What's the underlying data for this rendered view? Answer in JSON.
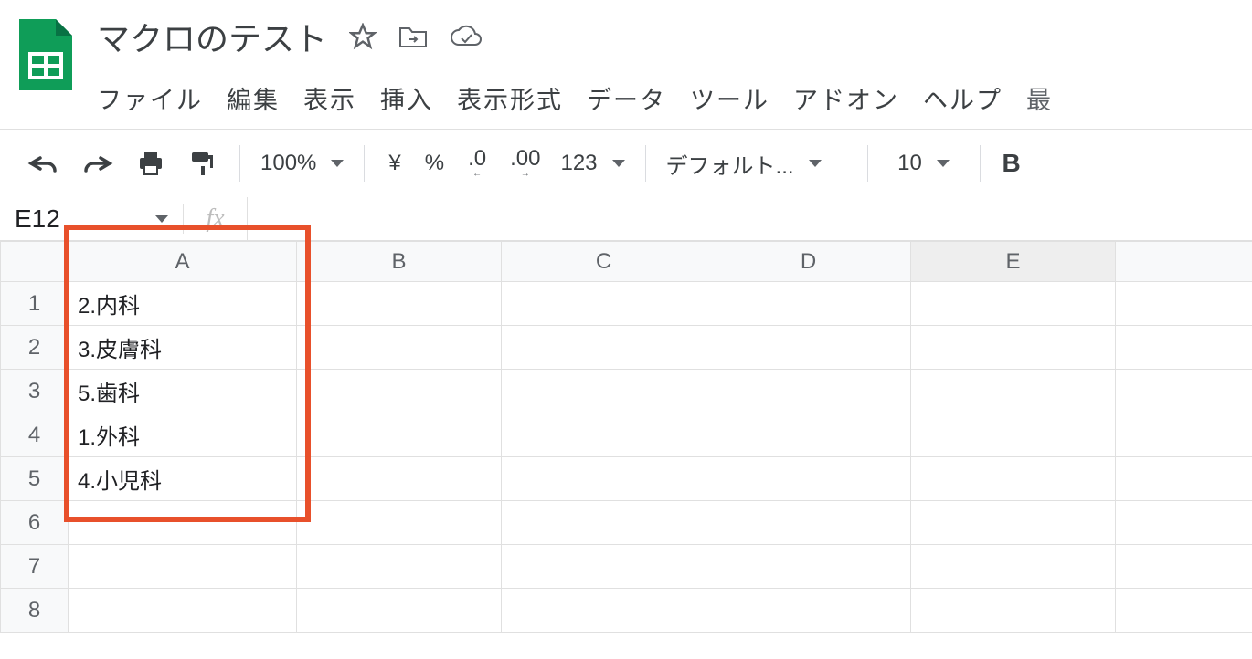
{
  "header": {
    "title": "マクロのテスト"
  },
  "menu": {
    "file": "ファイル",
    "edit": "編集",
    "view": "表示",
    "insert": "挿入",
    "format": "表示形式",
    "data": "データ",
    "tools": "ツール",
    "addons": "アドオン",
    "help": "ヘルプ",
    "last": "最"
  },
  "toolbar": {
    "zoom": "100%",
    "currency": "¥",
    "percent": "%",
    "dec_decrease": ".0",
    "dec_increase": ".00",
    "more_formats": "123",
    "font": "デフォルト...",
    "font_size": "10",
    "bold": "B"
  },
  "namebox": {
    "ref": "E12",
    "fx": "fx"
  },
  "columns": [
    "A",
    "B",
    "C",
    "D",
    "E",
    ""
  ],
  "rows": [
    "1",
    "2",
    "3",
    "4",
    "5",
    "6",
    "7",
    "8"
  ],
  "cells": {
    "A1": "2.内科",
    "A2": "3.皮膚科",
    "A3": "5.歯科",
    "A4": "1.外科",
    "A5": "4.小児科"
  },
  "selected_column_index": 4
}
